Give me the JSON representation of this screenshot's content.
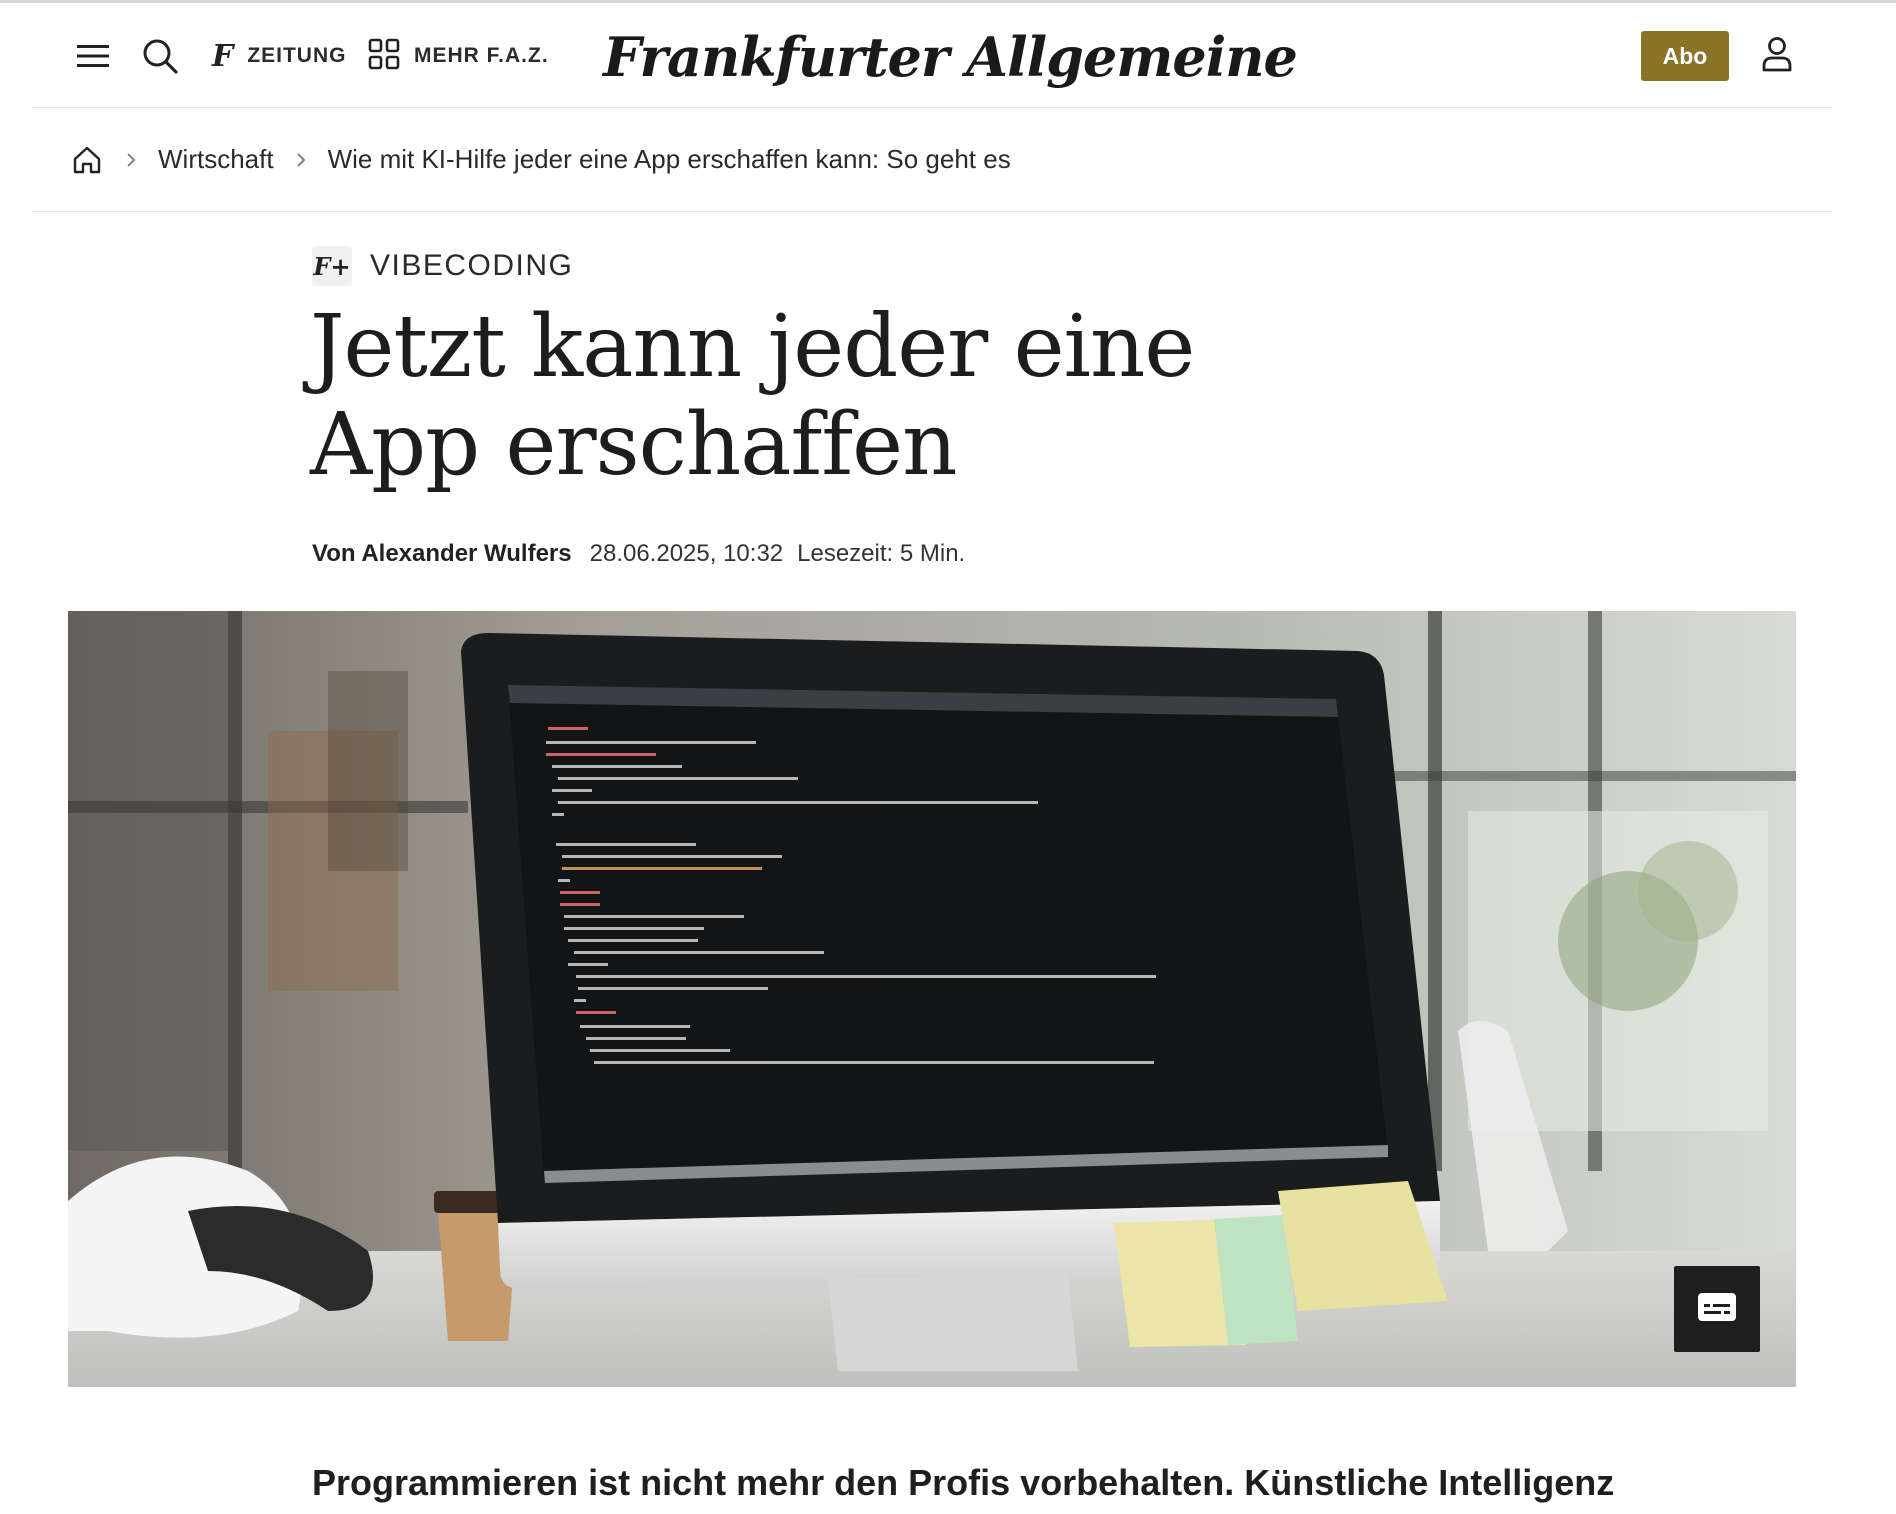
{
  "header": {
    "zeitung_label": "ZEITUNG",
    "mehr_label": "MEHR F.A.Z.",
    "logo_text": "Frankfurter Allgemeine",
    "abo_label": "Abo",
    "accent_color": "#8a7428"
  },
  "breadcrumb": {
    "items": [
      "Wirtschaft",
      "Wie mit KI-Hilfe jeder eine App erschaffen kann: So geht es"
    ]
  },
  "article": {
    "badge": "F+",
    "kicker": "VIBECODING",
    "title": "Jetzt kann jeder eine App erschaffen",
    "author": "Von Alexander Wulfers",
    "date": "28.06.2025, 10:32",
    "reading_time": "Lesezeit: 5 Min.",
    "lead": "Programmieren ist nicht mehr den Profis vorbehalten. Künstliche Intelligenz"
  },
  "icons": {
    "menu": "menu-icon",
    "search": "search-icon",
    "zeitung": "faz-f-icon",
    "mehr": "grid-icon",
    "user": "user-icon",
    "home": "home-icon",
    "caption": "subtitles-icon"
  }
}
